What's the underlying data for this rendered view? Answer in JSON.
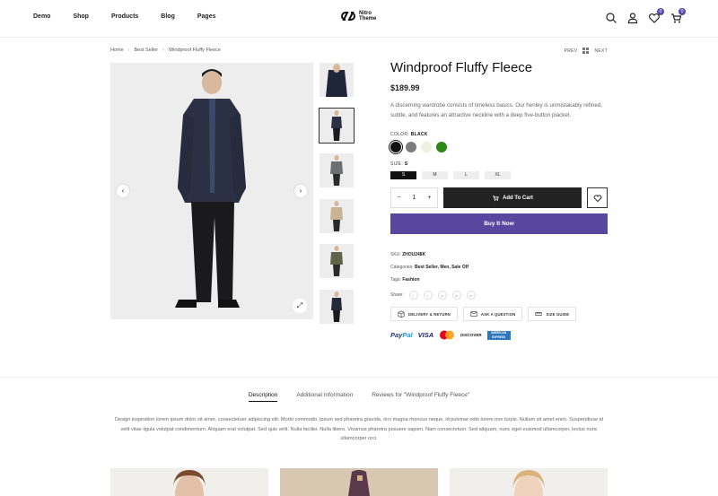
{
  "nav": {
    "items": [
      "Demo",
      "Shop",
      "Products",
      "Blog",
      "Pages"
    ]
  },
  "logo": {
    "line1": "Nitro",
    "line2": "Theme"
  },
  "header_icons": {
    "search": "search-icon",
    "account": "user-icon",
    "wishlist": "heart-icon",
    "wishlist_count": "0",
    "cart": "cart-icon",
    "cart_count": "0"
  },
  "breadcrumb": {
    "items": [
      "Home",
      "Best Seller",
      "Windproof Fluffy Fleece"
    ],
    "prev": "PREV",
    "next": "NEXT"
  },
  "product": {
    "title": "Windproof Fluffy Fleece",
    "price": "$189.99",
    "description": "A discerning wardrobe consists of timeless basics. Our henley is unmistakably refined, subtle, and features an attractive neckline with a deep five-button placket.",
    "color_label": "COLOR:",
    "color_value": "BLACK",
    "colors": [
      {
        "name": "black",
        "hex": "#111111"
      },
      {
        "name": "gray",
        "hex": "#7d7d7d"
      },
      {
        "name": "cream",
        "hex": "#eef0e2"
      },
      {
        "name": "green",
        "hex": "#2d8a12"
      }
    ],
    "size_label": "SIZE:",
    "size_value": "S",
    "sizes": [
      "S",
      "M",
      "L",
      "XL"
    ],
    "qty": "1",
    "qty_minus": "−",
    "qty_plus": "+",
    "add_to_cart": "Add To Cart",
    "buy_now": "Buy It Now",
    "sku_label": "SKU:",
    "sku": "ZHOU248K",
    "categories_label": "Categories:",
    "categories": "Best Seller, Men, Sale Off",
    "tags_label": "Tags:",
    "tags": "Fashion",
    "share_label": "Share:",
    "share_icons": [
      "f",
      "t",
      "p",
      "in",
      "m"
    ],
    "info_buttons": [
      "DELIVERY & RETURN",
      "ASK A QUESTION",
      "SIZE GUIDE"
    ],
    "payments": {
      "paypal_a": "Pay",
      "paypal_b": "Pal",
      "visa": "VISA",
      "discover": "DISCOVER",
      "amex": "AMERICAN EXPRESS"
    }
  },
  "tabs": {
    "items": [
      "Description",
      "Additional Information",
      "Reviews for \"Windproof Fluffy Fleece\""
    ],
    "active_index": 0,
    "description_text": "Design inspiration lorem ipsum dolor sit amet, consectetuer adipiscing elit. Morbi commodo, ipsum sed pharetra gravida, orci magna rhoncus neque, id pulvinar odio lorem non turpis. Nullam sit amet enim. Suspendisse id velit vitae ligula volutpat condimentum. Aliquam erat volutpat. Sed quis velit. Nulla facilisi. Nulla libero. Vivamus pharetra posuere sapien. Nam consectetuer. Sed aliquam, nunc eget euismod ullamcorper, lectus nunc ullamcorper orci."
  },
  "colors": {
    "accent": "#58479e",
    "dark_button": "#222222"
  }
}
